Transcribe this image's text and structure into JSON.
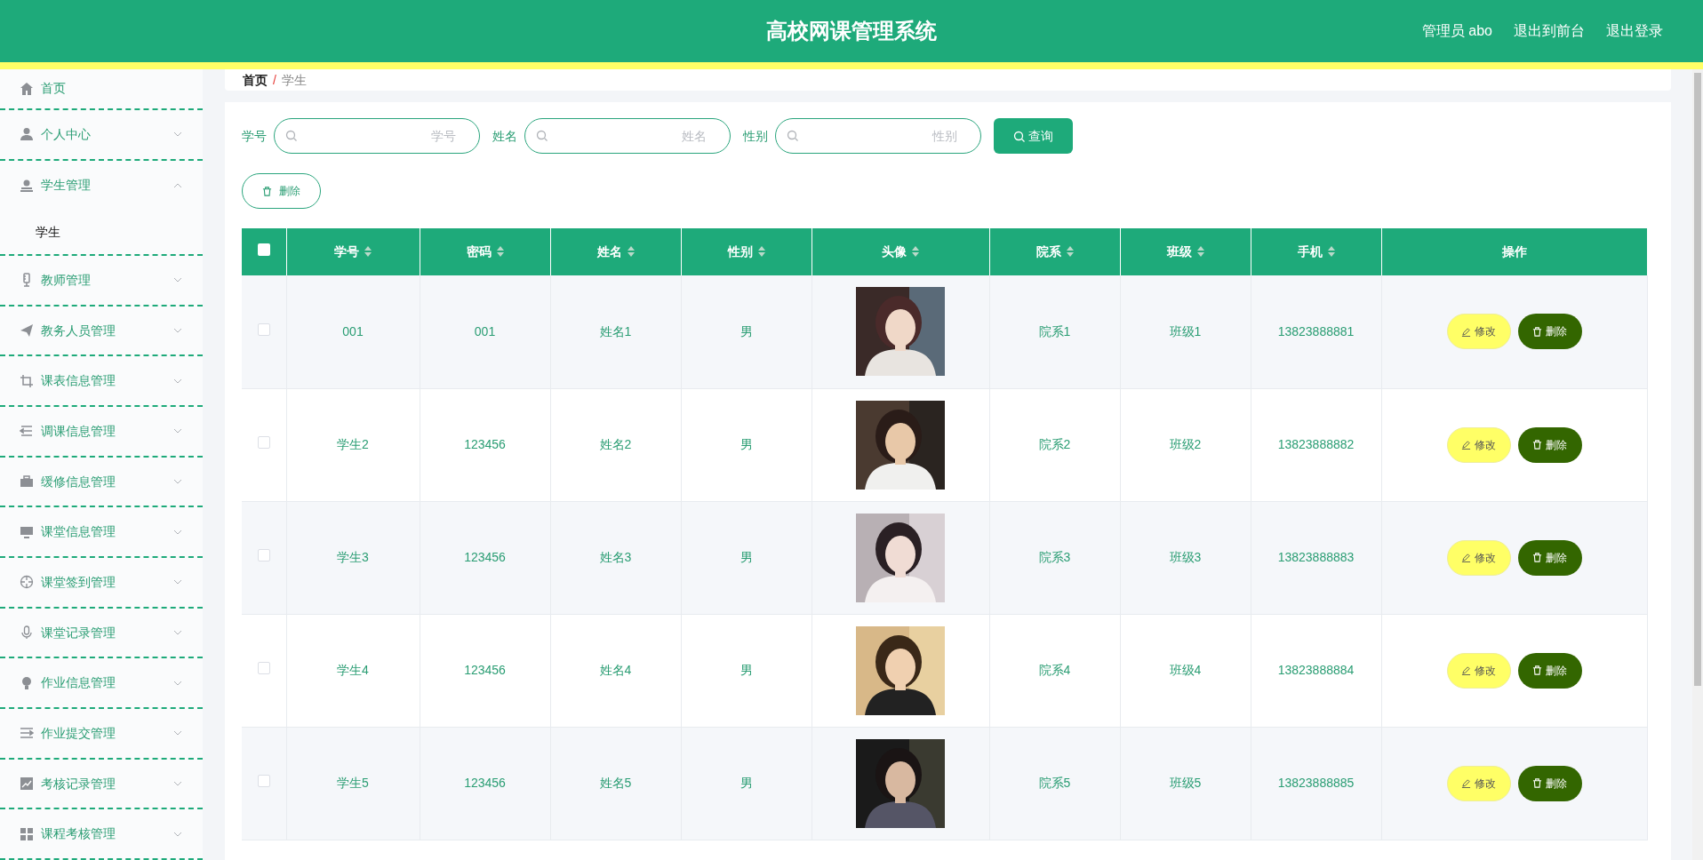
{
  "header": {
    "title": "高校网课管理系统",
    "links": [
      "管理员 abo",
      "退出到前台",
      "退出登录"
    ]
  },
  "sidebar": {
    "items": [
      {
        "label": "首页",
        "kind": "link"
      },
      {
        "label": "个人中心",
        "kind": "menu",
        "expanded": false
      },
      {
        "label": "学生管理",
        "kind": "menu",
        "expanded": true,
        "children": [
          {
            "label": "学生"
          }
        ]
      },
      {
        "label": "教师管理",
        "kind": "menu",
        "expanded": false
      },
      {
        "label": "教务人员管理",
        "kind": "menu",
        "expanded": false
      },
      {
        "label": "课表信息管理",
        "kind": "menu",
        "expanded": false
      },
      {
        "label": "调课信息管理",
        "kind": "menu",
        "expanded": false
      },
      {
        "label": "缓修信息管理",
        "kind": "menu",
        "expanded": false
      },
      {
        "label": "课堂信息管理",
        "kind": "menu",
        "expanded": false
      },
      {
        "label": "课堂签到管理",
        "kind": "menu",
        "expanded": false
      },
      {
        "label": "课堂记录管理",
        "kind": "menu",
        "expanded": false
      },
      {
        "label": "作业信息管理",
        "kind": "menu",
        "expanded": false
      },
      {
        "label": "作业提交管理",
        "kind": "menu",
        "expanded": false
      },
      {
        "label": "考核记录管理",
        "kind": "menu",
        "expanded": false
      },
      {
        "label": "课程考核管理",
        "kind": "menu",
        "expanded": false
      }
    ]
  },
  "breadcrumb": {
    "items": [
      "首页",
      "学生"
    ],
    "separator": "/"
  },
  "search": {
    "fields": [
      {
        "label": "学号",
        "placeholder": "学号"
      },
      {
        "label": "姓名",
        "placeholder": "姓名"
      },
      {
        "label": "性别",
        "placeholder": "性别"
      }
    ],
    "button": "查询"
  },
  "delete_button": "删除",
  "table": {
    "select_all": {
      "checked": false
    },
    "columns": [
      {
        "label": "学号",
        "sortable": true
      },
      {
        "label": "密码",
        "sortable": true
      },
      {
        "label": "姓名",
        "sortable": true
      },
      {
        "label": "性别",
        "sortable": true
      },
      {
        "label": "头像",
        "sortable": true
      },
      {
        "label": "院系",
        "sortable": true
      },
      {
        "label": "班级",
        "sortable": true
      },
      {
        "label": "手机",
        "sortable": true
      },
      {
        "label": "操作",
        "sortable": false
      }
    ],
    "rows": [
      {
        "checked": false,
        "cells": [
          "001",
          "001",
          "姓名1",
          "男",
          {
            "kind": "picture"
          },
          "院系1",
          "班级1",
          "13823888881"
        ],
        "actions": [
          {
            "label": "修改",
            "kind": "edit"
          },
          {
            "label": "删除",
            "kind": "delete"
          }
        ]
      },
      {
        "checked": false,
        "cells": [
          "学生2",
          "123456",
          "姓名2",
          "男",
          {
            "kind": "picture"
          },
          "院系2",
          "班级2",
          "13823888882"
        ],
        "actions": [
          {
            "label": "修改",
            "kind": "edit"
          },
          {
            "label": "删除",
            "kind": "delete"
          }
        ]
      },
      {
        "checked": false,
        "cells": [
          "学生3",
          "123456",
          "姓名3",
          "男",
          {
            "kind": "picture"
          },
          "院系3",
          "班级3",
          "13823888883"
        ],
        "actions": [
          {
            "label": "修改",
            "kind": "edit"
          },
          {
            "label": "删除",
            "kind": "delete"
          }
        ]
      },
      {
        "checked": false,
        "cells": [
          "学生4",
          "123456",
          "姓名4",
          "男",
          {
            "kind": "picture"
          },
          "院系4",
          "班级4",
          "13823888884"
        ],
        "actions": [
          {
            "label": "修改",
            "kind": "edit"
          },
          {
            "label": "删除",
            "kind": "delete"
          }
        ]
      },
      {
        "checked": false,
        "cells": [
          "学生5",
          "123456",
          "姓名5",
          "男",
          {
            "kind": "picture"
          },
          "院系5",
          "班级5",
          "13823888885"
        ],
        "actions": [
          {
            "label": "修改",
            "kind": "edit"
          },
          {
            "label": "删除",
            "kind": "delete"
          }
        ]
      }
    ]
  }
}
